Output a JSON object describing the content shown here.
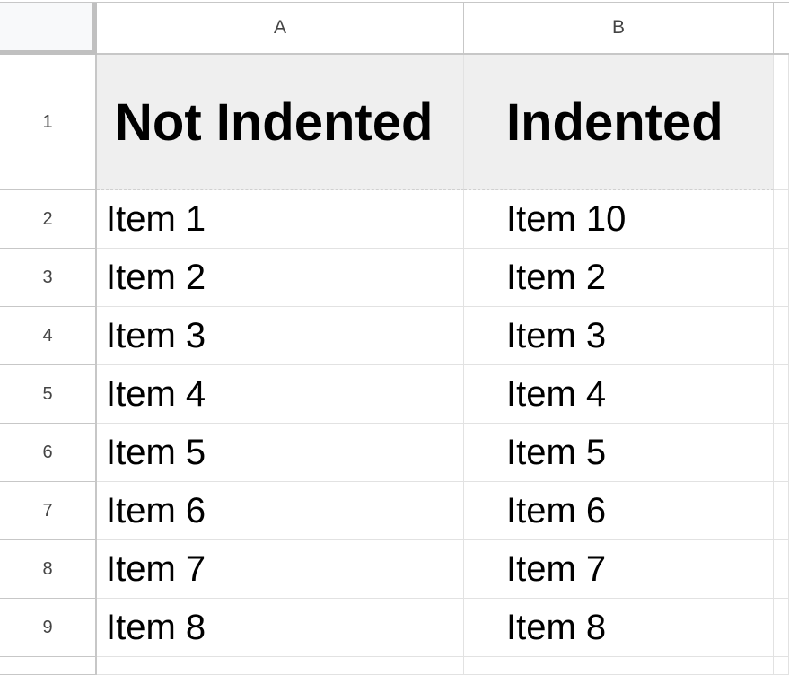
{
  "sheet": {
    "columns": [
      "A",
      "B"
    ],
    "rows": [
      {
        "num": "1",
        "a": "Not Indented",
        "b": "Indented",
        "header": true
      },
      {
        "num": "2",
        "a": "Item 1",
        "b": "Item 10"
      },
      {
        "num": "3",
        "a": "Item 2",
        "b": "Item 2"
      },
      {
        "num": "4",
        "a": "Item 3",
        "b": "Item 3"
      },
      {
        "num": "5",
        "a": "Item 4",
        "b": "Item 4"
      },
      {
        "num": "6",
        "a": "Item 5",
        "b": "Item 5"
      },
      {
        "num": "7",
        "a": "Item 6",
        "b": "Item 6"
      },
      {
        "num": "8",
        "a": "Item 7",
        "b": "Item 7"
      },
      {
        "num": "9",
        "a": "Item 8",
        "b": "Item 8"
      }
    ],
    "colors": {
      "header_fill": "#efefef",
      "grid_line": "#e2e2e2",
      "header_border": "#c7c7c7",
      "corner_fill": "#f8f9fa"
    }
  }
}
